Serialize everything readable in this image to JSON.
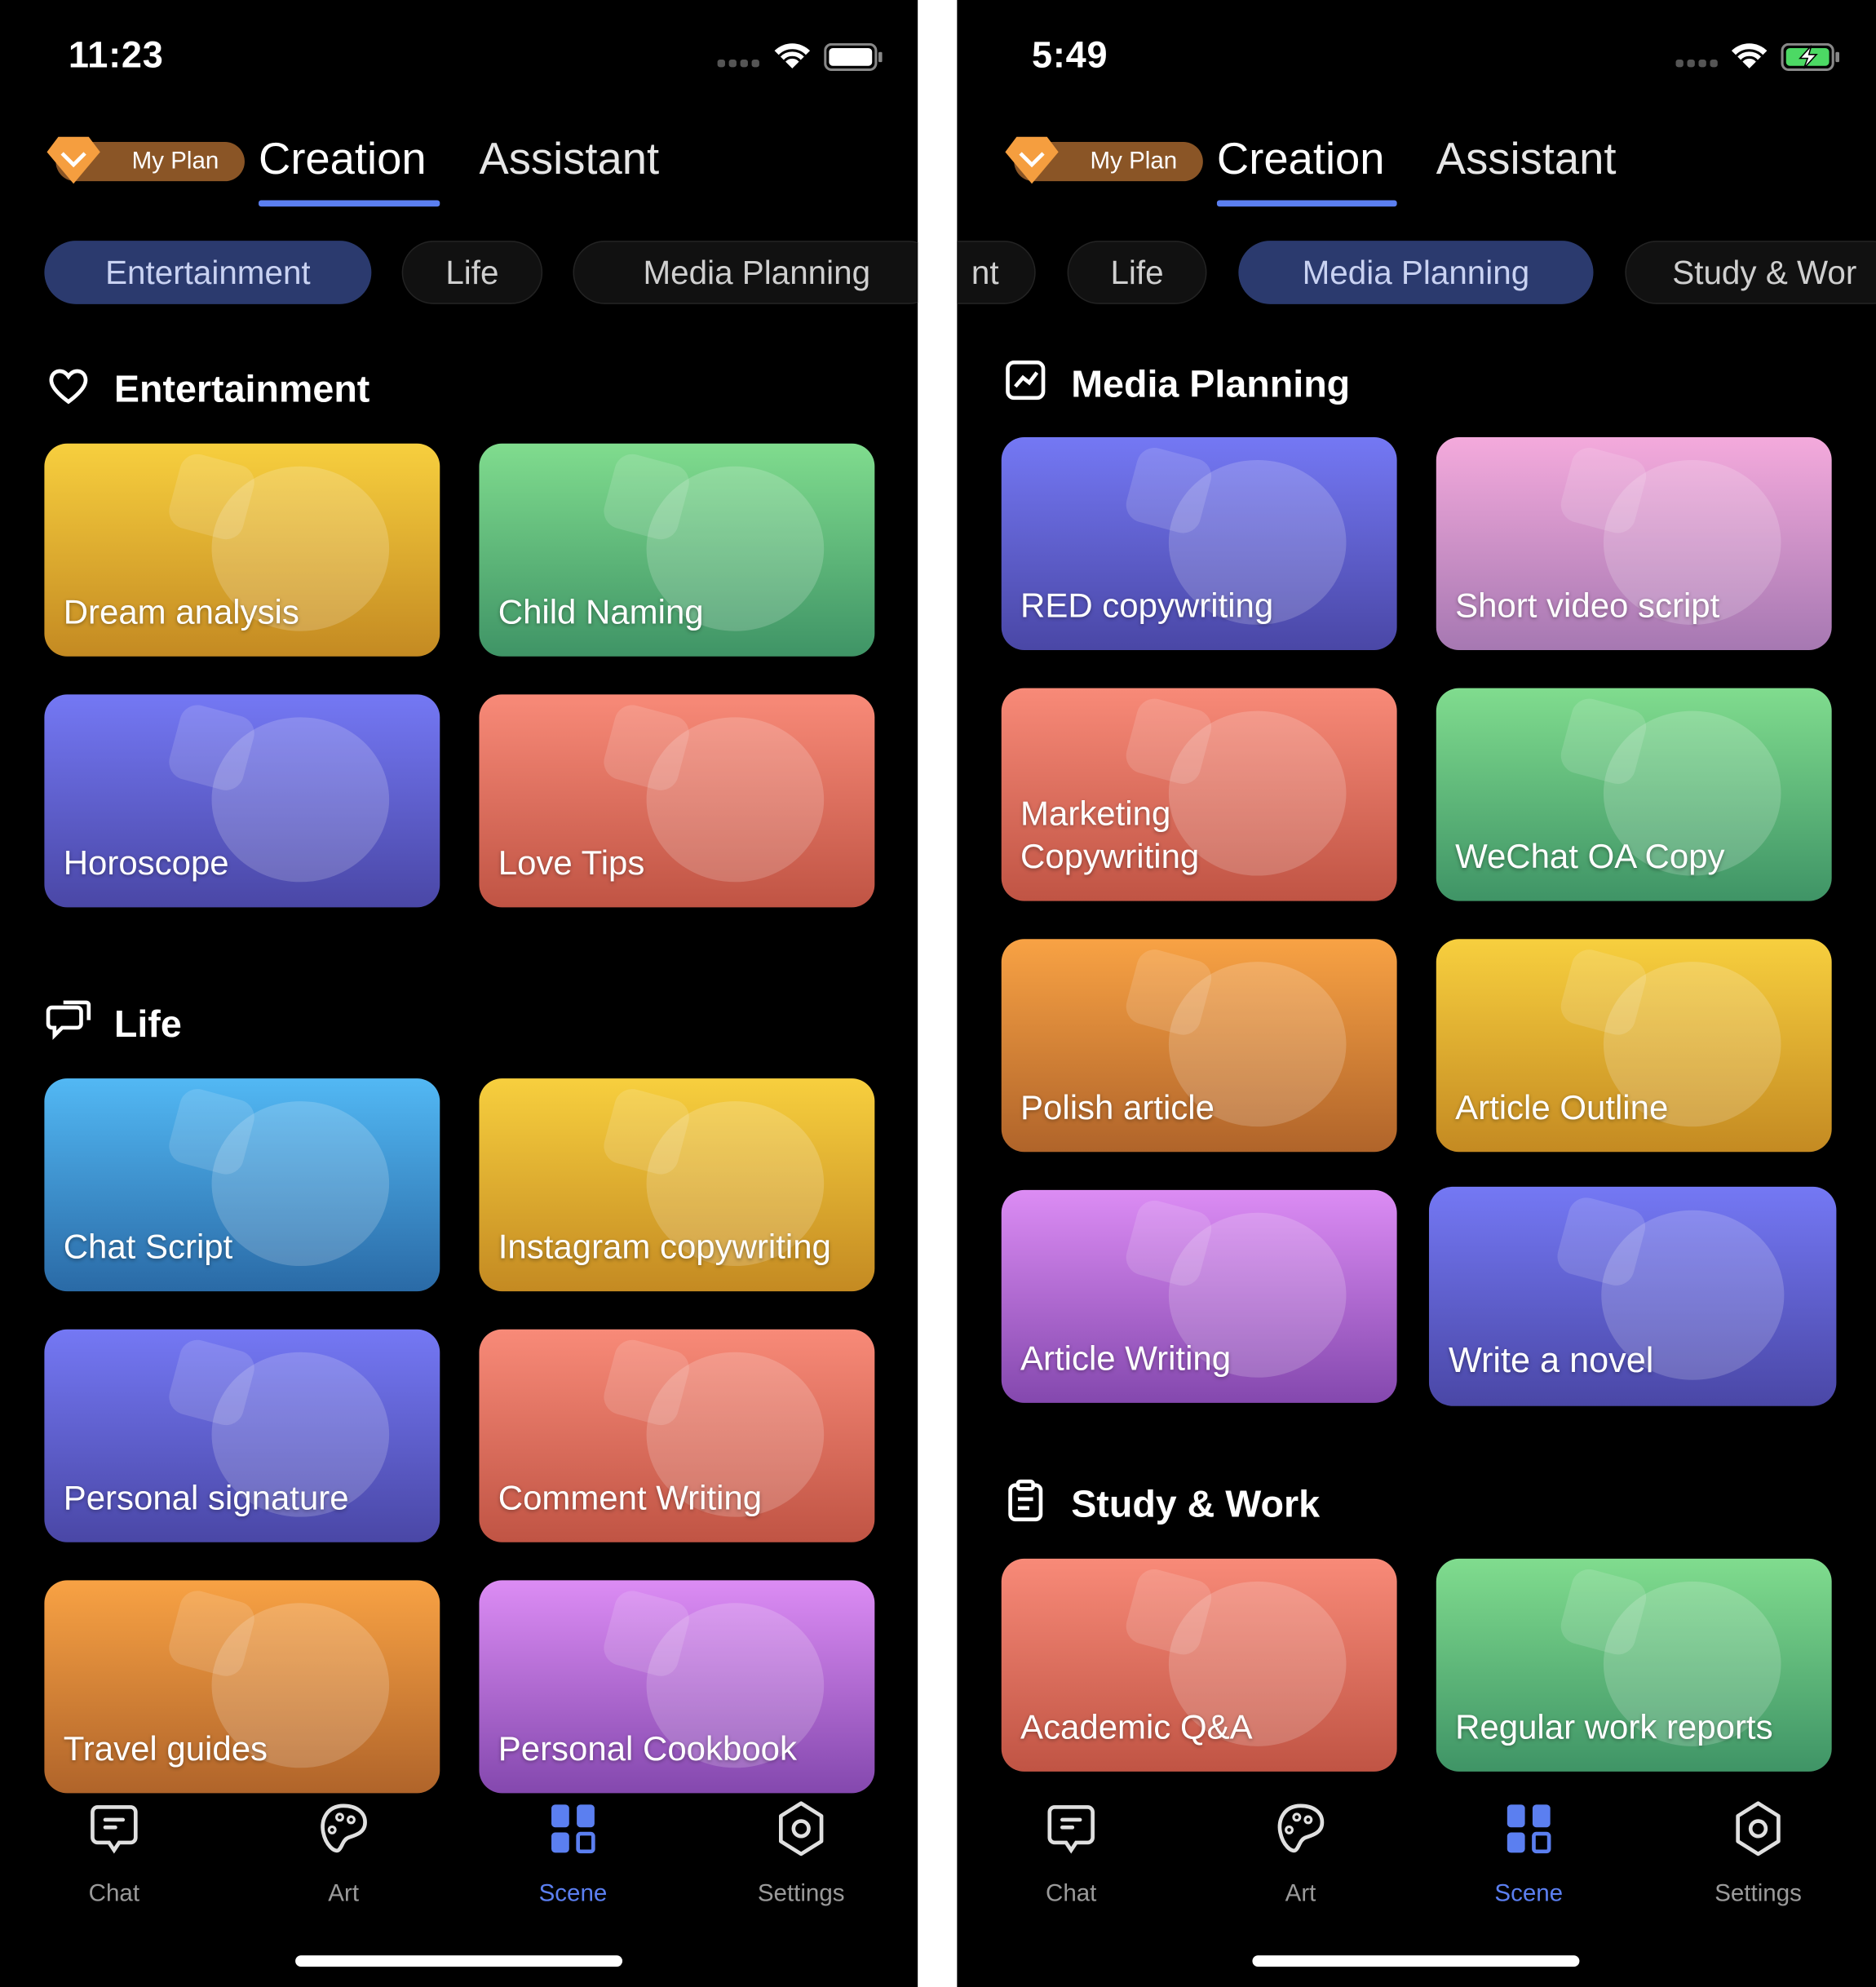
{
  "colors": {
    "accent": "#5b7ff0",
    "active_chip": "#2b3a6e",
    "plan_badge": "#8a5526",
    "gem": "#f59e3f",
    "battery_charging": "#4cd964"
  },
  "screens": [
    {
      "status": {
        "time": "11:23",
        "battery": "full"
      },
      "header": {
        "plan_label": "My Plan",
        "tabs": [
          {
            "label": "Creation",
            "active": true
          },
          {
            "label": "Assistant",
            "active": false
          }
        ]
      },
      "chips": [
        {
          "label": "Entertainment",
          "active": true
        },
        {
          "label": "Life",
          "active": false
        },
        {
          "label": "Media Planning",
          "active": false
        }
      ],
      "sections": [
        {
          "title": "Entertainment",
          "icon": "heart-icon",
          "cards": [
            {
              "label": "Dream analysis",
              "theme": "yellow"
            },
            {
              "label": "Child Naming",
              "theme": "green"
            },
            {
              "label": "Horoscope",
              "theme": "blue"
            },
            {
              "label": "Love Tips",
              "theme": "coral"
            }
          ]
        },
        {
          "title": "Life",
          "icon": "chat-bubbles-icon",
          "cards": [
            {
              "label": "Chat Script",
              "theme": "cyan"
            },
            {
              "label": "Instagram copywriting",
              "theme": "yellow"
            },
            {
              "label": "Personal signature",
              "theme": "blue"
            },
            {
              "label": "Comment Writing",
              "theme": "coral"
            },
            {
              "label": "Travel guides",
              "theme": "orange"
            },
            {
              "label": "Personal Cookbook",
              "theme": "purple"
            }
          ]
        }
      ],
      "nav": [
        {
          "label": "Chat",
          "icon": "chat-icon"
        },
        {
          "label": "Art",
          "icon": "palette-icon"
        },
        {
          "label": "Scene",
          "icon": "grid-icon",
          "active": true
        },
        {
          "label": "Settings",
          "icon": "settings-icon"
        }
      ]
    },
    {
      "status": {
        "time": "5:49",
        "battery": "charging"
      },
      "header": {
        "plan_label": "My Plan",
        "tabs": [
          {
            "label": "Creation",
            "active": true
          },
          {
            "label": "Assistant",
            "active": false
          }
        ]
      },
      "chips": [
        {
          "label": "nt",
          "active": false
        },
        {
          "label": "Life",
          "active": false
        },
        {
          "label": "Media Planning",
          "active": true
        },
        {
          "label": "Study & Wor",
          "active": false
        }
      ],
      "sections": [
        {
          "title": "Media Planning",
          "icon": "chart-icon",
          "cards": [
            {
              "label": "RED copywriting",
              "theme": "blue"
            },
            {
              "label": "Short video script",
              "theme": "pink"
            },
            {
              "label": "Marketing Copywriting",
              "theme": "coral"
            },
            {
              "label": "WeChat OA Copy",
              "theme": "green"
            },
            {
              "label": "Polish article",
              "theme": "orange"
            },
            {
              "label": "Article Outline",
              "theme": "yellow"
            },
            {
              "label": "Article Writing",
              "theme": "purple"
            },
            {
              "label": "Write a novel",
              "theme": "blue"
            }
          ]
        },
        {
          "title": "Study & Work",
          "icon": "clipboard-icon",
          "cards": [
            {
              "label": "Academic Q&A",
              "theme": "coral"
            },
            {
              "label": "Regular work reports",
              "theme": "green"
            }
          ]
        }
      ],
      "nav": [
        {
          "label": "Chat",
          "icon": "chat-icon"
        },
        {
          "label": "Art",
          "icon": "palette-icon"
        },
        {
          "label": "Scene",
          "icon": "grid-icon",
          "active": true
        },
        {
          "label": "Settings",
          "icon": "settings-icon"
        }
      ]
    }
  ]
}
